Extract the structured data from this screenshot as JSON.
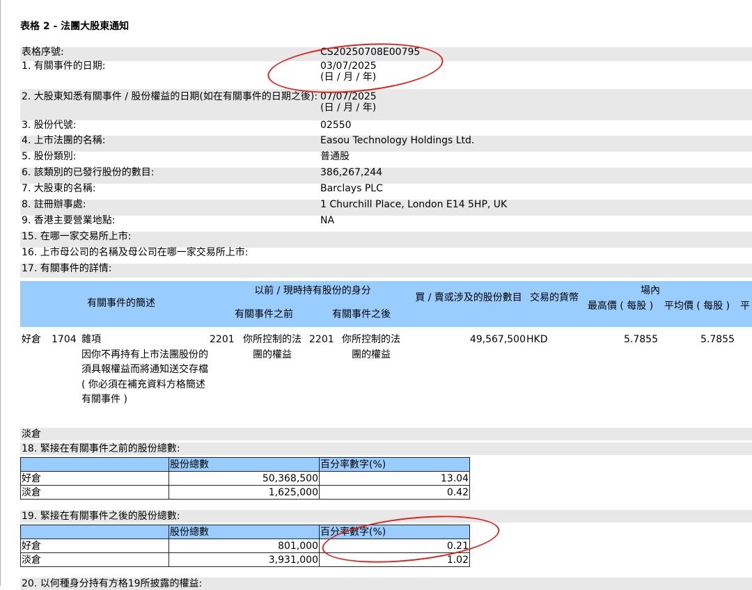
{
  "page_title": "表格 2 - 法團大股東通知",
  "info_rows": [
    {
      "label": "表格序號:",
      "value": "CS20250708E00795",
      "value2": ""
    },
    {
      "label": "1. 有關事件的日期:",
      "value": "03/07/2025",
      "value2": "(日 / 月 / 年)"
    },
    {
      "label": "2. 大股東知悉有關事件 / 股份權益的日期(如在有關事件的日期之後):",
      "value": "07/07/2025",
      "value2": "(日 / 月 / 年)"
    },
    {
      "label": "3. 股份代號:",
      "value": "02550",
      "value2": ""
    },
    {
      "label": "4. 上市法團的名稱:",
      "value": "Easou Technology Holdings Ltd.",
      "value2": ""
    },
    {
      "label": "5. 股份類別:",
      "value": "普通股",
      "value2": ""
    },
    {
      "label": "6. 該類別的已發行股份的數目:",
      "value": "386,267,244",
      "value2": ""
    },
    {
      "label": "7. 大股東的名稱:",
      "value": "Barclays PLC",
      "value2": ""
    },
    {
      "label": "8. 註冊辦事處:",
      "value": "1 Churchill Place, London E14 5HP, UK",
      "value2": ""
    },
    {
      "label": "9. 香港主要營業地點:",
      "value": "NA",
      "value2": ""
    },
    {
      "label": "15. 在哪一家交易所上市:",
      "value": "",
      "value2": ""
    },
    {
      "label": "16. 上市母公司的名稱及母公司在哪一家交易所上市:",
      "value": "",
      "value2": ""
    },
    {
      "label": "17. 有關事件的詳情:",
      "value": "",
      "value2": ""
    }
  ],
  "details": {
    "headers": {
      "desc": "有關事件的簡述",
      "capacity_group": "以前 / 現時持有股份的身分",
      "before": "有關事件之前",
      "after": "有關事件之後",
      "shares": "買 / 賣或涉及的股份數目",
      "currency": "交易的貨幣",
      "onmarket": "場內",
      "highest": "最高價 ( 每股 )",
      "average": "平均價 ( 每股 )",
      "cut": "平"
    },
    "row": {
      "position": "好倉",
      "code": "1704",
      "desc": "雜項\n因你不再持有上市法團股份的須具報權益而將通知送交存檔 ( 你必須在補充資料方格簡述有關事件 )",
      "before_code": "2201",
      "before_text": "你所控制的法團的權益",
      "after_code": "2201",
      "after_text": "你所控制的法團的權益",
      "shares": "49,567,500",
      "currency": "HKD",
      "highest": "5.7855",
      "average": "5.7855"
    },
    "short_label": "淡倉"
  },
  "section18": {
    "title": "18. 緊接在有關事件之前的股份總數:",
    "col_shares": "股份總數",
    "col_pct": "百分率數字(%)",
    "rows": [
      {
        "label": "好倉",
        "shares": "50,368,500",
        "pct": "13.04"
      },
      {
        "label": "淡倉",
        "shares": "1,625,000",
        "pct": "0.42"
      }
    ]
  },
  "section19": {
    "title": "19. 緊接在有關事件之後的股份總數:",
    "col_shares": "股份總數",
    "col_pct": "百分率數字(%)",
    "rows": [
      {
        "label": "好倉",
        "shares": "801,000",
        "pct": "0.21"
      },
      {
        "label": "淡倉",
        "shares": "3,931,000",
        "pct": "1.02"
      }
    ]
  },
  "section20_title": "20. 以何種身分持有方格19所披露的權益:",
  "colors": {
    "header_blue": "#99ccff",
    "row_gray": "#e8e8e8",
    "annotation_red": "#e0221c"
  }
}
